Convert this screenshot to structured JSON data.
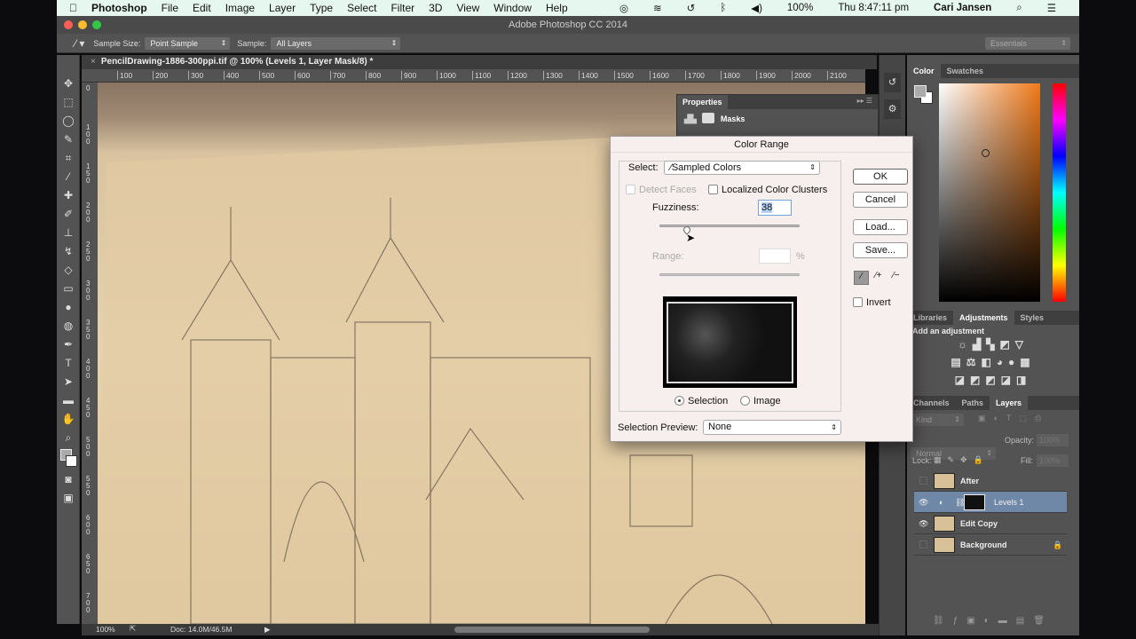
{
  "menubar": {
    "app": "Photoshop",
    "items": [
      "File",
      "Edit",
      "Image",
      "Layer",
      "Type",
      "Select",
      "Filter",
      "3D",
      "View",
      "Window",
      "Help"
    ],
    "battery": "100%",
    "clock": "Thu 8:47:11 pm",
    "user": "Cari Jansen"
  },
  "window": {
    "title": "Adobe Photoshop CC 2014"
  },
  "options": {
    "sample_size_label": "Sample Size:",
    "sample_size": "Point Sample",
    "sample_label": "Sample:",
    "sample": "All Layers",
    "workspace": "Essentials"
  },
  "document": {
    "tab": "PencilDrawing-1886-300ppi.tif @ 100% (Levels 1, Layer Mask/8) *",
    "ruler_h": [
      "100",
      "200",
      "300",
      "400",
      "500",
      "600",
      "700",
      "800",
      "900",
      "1000",
      "1100",
      "1200",
      "1300",
      "1400",
      "1500",
      "1600",
      "1700",
      "1800",
      "1900",
      "2000",
      "2100"
    ],
    "ruler_v": [
      "0",
      "1 0 0",
      "1 5 0",
      "2 0 0",
      "2 5 0",
      "3 0 0",
      "3 5 0",
      "4 0 0",
      "4 5 0",
      "5 0 0",
      "5 5 0",
      "6 0 0",
      "6 5 0",
      "7 0 0"
    ]
  },
  "status": {
    "zoom": "100%",
    "doc": "Doc: 14.0M/46.5M"
  },
  "properties": {
    "title": "Properties",
    "section": "Masks"
  },
  "color_panel": {
    "tabs": [
      "Color",
      "Swatches"
    ]
  },
  "adjustments": {
    "tabs": [
      "Libraries",
      "Adjustments",
      "Styles"
    ],
    "heading": "Add an adjustment"
  },
  "layers_panel": {
    "tabs": [
      "Channels",
      "Paths",
      "Layers"
    ],
    "kind": "Kind",
    "blend": "Normal",
    "opacity_label": "Opacity:",
    "opacity": "100%",
    "lock_label": "Lock:",
    "fill_label": "Fill:",
    "fill": "100%",
    "layers": [
      {
        "name": "After",
        "visible": false
      },
      {
        "name": "Levels 1",
        "visible": true,
        "selected": true
      },
      {
        "name": "Edit Copy",
        "visible": true
      },
      {
        "name": "Background",
        "visible": false,
        "locked": true
      }
    ]
  },
  "dialog": {
    "title": "Color Range",
    "select_label": "Select:",
    "select_value": "Sampled Colors",
    "detect_faces": "Detect Faces",
    "localized": "Localized Color Clusters",
    "fuzziness_label": "Fuzziness:",
    "fuzziness": "38",
    "fuzziness_fraction": 0.19,
    "range_label": "Range:",
    "range_unit": "%",
    "radio_selection": "Selection",
    "radio_image": "Image",
    "preview_label": "Selection Preview:",
    "preview_value": "None",
    "ok": "OK",
    "cancel": "Cancel",
    "load": "Load...",
    "save": "Save...",
    "invert": "Invert"
  }
}
